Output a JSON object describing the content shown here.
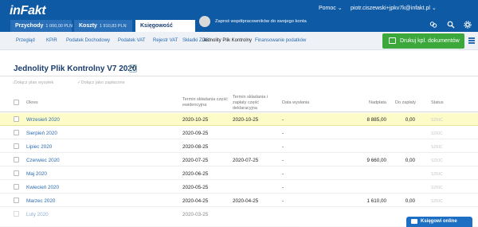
{
  "app": {
    "logo": "inFakt"
  },
  "header": {
    "help_label": "Pomoc ⌄",
    "user_email": "piotr.ciszewski+jpkv7k@infakt.pl ⌄",
    "invite_text": "Zaproś współpracowników do swojego konta",
    "tabs": [
      {
        "label": "Przychody",
        "amount": "1 000,00 PLN"
      },
      {
        "label": "Koszty",
        "amount": "1 910,83 PLN"
      },
      {
        "label": "Księgowość",
        "amount": ""
      }
    ],
    "icons": [
      "cart-icon",
      "search-icon",
      "gear-icon"
    ]
  },
  "subnav": {
    "items": [
      "Przegląd",
      "KPiR",
      "Podatek Dochodowy",
      "Podatek VAT",
      "Rejestr VAT",
      "Składki ZUS",
      "Jednolity Plik Kontrolny",
      "Finansowanie podatków"
    ],
    "print_button": "Drukuj kpl. dokumentów"
  },
  "page": {
    "title": "Jednolity Plik Kontrolny V7 2020",
    "dropdown_glyph": "▾",
    "actions": [
      "Dołącz plan wysyłek",
      "Dołącz jako zapłacone"
    ]
  },
  "table": {
    "headers": {
      "okres": "Okres",
      "termin_ewid": "Termin składania część ewidencyjna",
      "termin_dekl": "Termin składania i zapłaty część deklaracyjna",
      "data_wyslania": "Data wysłania",
      "nadplata": "Nadpłata",
      "do_zaplaty": "Do zapłaty",
      "status": "Status"
    },
    "rows": [
      {
        "okres": "Wrzesień 2020",
        "d1": "2020-10-25",
        "d2": "2020-10-25",
        "d3": "-",
        "nadplata": "8 885,00",
        "do_zaplaty": "0,00",
        "status": "SZKIC"
      },
      {
        "okres": "Sierpień 2020",
        "d1": "2020-09-25",
        "d2": "",
        "d3": "-",
        "nadplata": "",
        "do_zaplaty": "",
        "status": "SZKIC"
      },
      {
        "okres": "Lipiec 2020",
        "d1": "2020-08-25",
        "d2": "",
        "d3": "-",
        "nadplata": "",
        "do_zaplaty": "",
        "status": "SZKIC"
      },
      {
        "okres": "Czerwiec 2020",
        "d1": "2020-07-25",
        "d2": "2020-07-25",
        "d3": "-",
        "nadplata": "9 660,00",
        "do_zaplaty": "0,00",
        "status": "SZKIC"
      },
      {
        "okres": "Maj 2020",
        "d1": "2020-06-25",
        "d2": "",
        "d3": "-",
        "nadplata": "",
        "do_zaplaty": "",
        "status": "SZKIC"
      },
      {
        "okres": "Kwiecień 2020",
        "d1": "2020-05-25",
        "d2": "",
        "d3": "-",
        "nadplata": "",
        "do_zaplaty": "",
        "status": "SZKIC"
      },
      {
        "okres": "Marzec 2020",
        "d1": "2020-04-25",
        "d2": "2020-04-25",
        "d3": "-",
        "nadplata": "1 610,00",
        "do_zaplaty": "0,00",
        "status": "SZKIC"
      },
      {
        "okres": "Luty 2020",
        "d1": "2020-03-25",
        "d2": "",
        "d3": "",
        "nadplata": "",
        "do_zaplaty": "",
        "status": ""
      }
    ]
  },
  "chat": {
    "label": "Księgowi online"
  },
  "colors": {
    "brand": "#0f5aa4",
    "accent_green": "#3ca83c",
    "link": "#2a6ab0",
    "highlight_row": "#fdfbc8"
  }
}
